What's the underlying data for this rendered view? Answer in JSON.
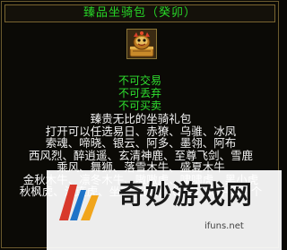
{
  "item": {
    "title": "臻品坐骑包（癸卯）",
    "icon": "mount-pack-icon",
    "bind_status": [
      "不可交易",
      "不可丢弃",
      "不可买卖"
    ],
    "description_lines": [
      "臻贵无比的坐骑礼包",
      "打开可以任选易日、赤獠、乌骓、冰凤",
      "索魂、啼晓、银云、阿多、墨翎、阿布",
      "西风烈、醉逍遥、玄清神鹿、至尊飞剑、雪鹿",
      "乘风、舞狮、落雪木牛、盛夏木牛",
      "金秋木牛、凛冬木牛、嗷嗷虎、啸啸虎、黑小虎",
      "秋枫虎、流连虎、坐骑兑换券（6级）其中的一个"
    ]
  },
  "watermark": {
    "text": "奇妙游戏网",
    "url": "ifuns.net"
  },
  "colors": {
    "title_green": "#27d527",
    "status_green": "#2fe02f",
    "desc_white": "#f3f3f3",
    "border_gold": "#7a6530",
    "background": "#0b0a06"
  }
}
